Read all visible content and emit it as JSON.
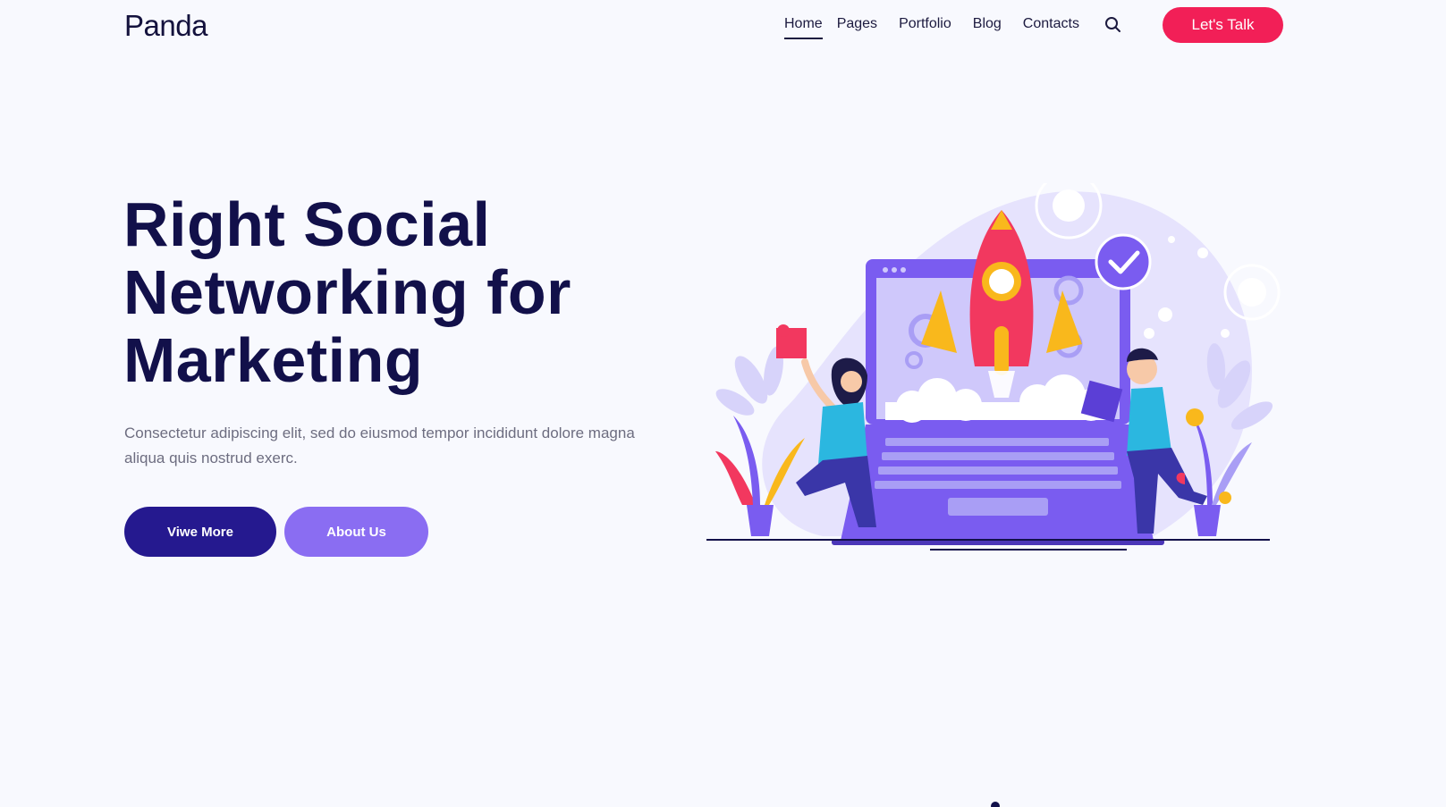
{
  "header": {
    "logo": "Panda",
    "nav": [
      {
        "label": "Home",
        "active": true
      },
      {
        "label": "Pages",
        "active": false
      },
      {
        "label": "Portfolio",
        "active": false
      },
      {
        "label": "Blog",
        "active": false
      },
      {
        "label": "Contacts",
        "active": false
      }
    ],
    "search_icon": "search-icon",
    "cta_label": "Let's Talk"
  },
  "hero": {
    "title_lines": [
      "Right Social",
      "Networking for",
      "Marketing"
    ],
    "description": "Consectetur adipiscing elit, sed do eiusmod tempor incididunt dolore magna aliqua quis nostrud exerc.",
    "primary_button": "Viwe More",
    "secondary_button": "About Us"
  },
  "colors": {
    "background": "#f8f9fe",
    "heading": "#12104a",
    "accent_red": "#f21f57",
    "primary_button": "#25198f",
    "secondary_button": "#8a6df2",
    "laptop_purple": "#7a5cf0",
    "rocket_yellow": "#f9b81c"
  },
  "illustration": "rocket-launch-laptop-illustration"
}
